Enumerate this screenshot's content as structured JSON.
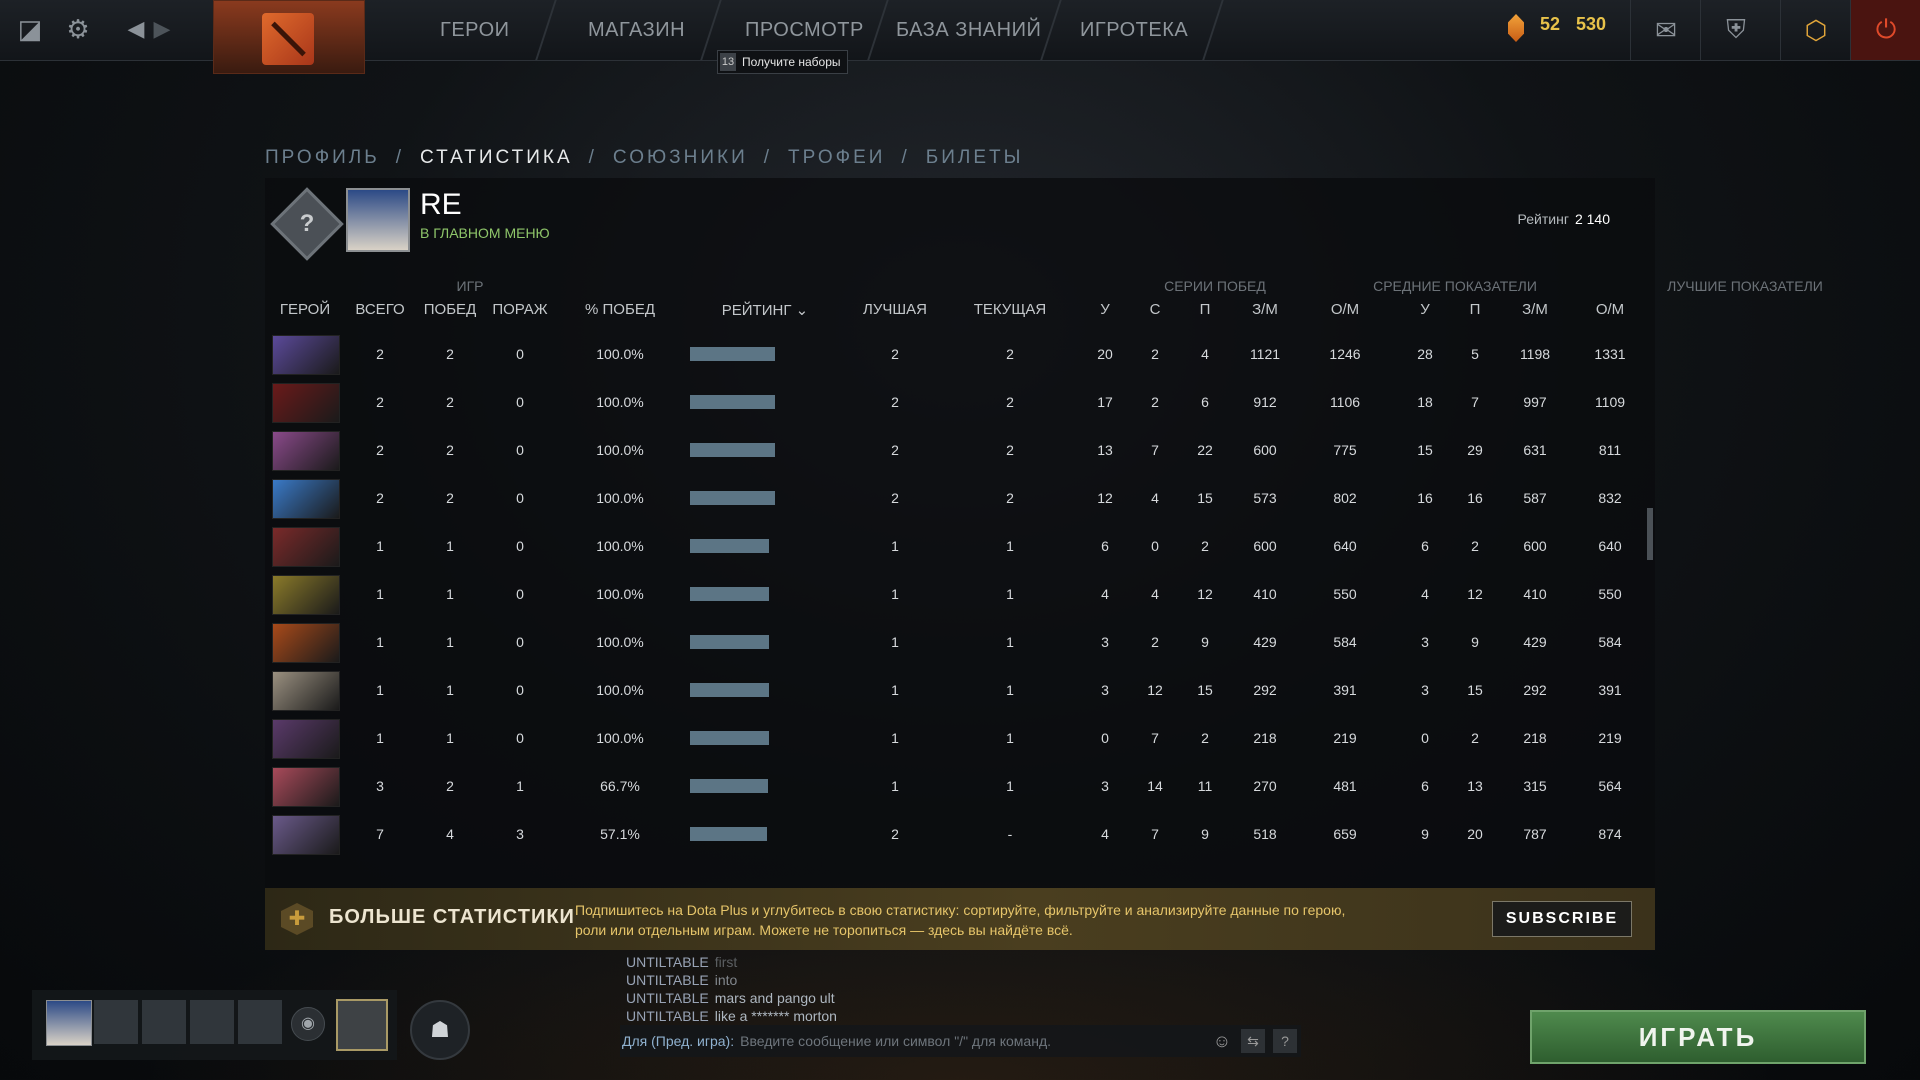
{
  "topbar": {
    "nav": [
      "ГЕРОИ",
      "МАГАЗИН",
      "ПРОСМОТР",
      "БАЗА ЗНАНИЙ",
      "ИГРОТЕКА"
    ],
    "tooltip_count": "13",
    "tooltip_text": "Получите наборы",
    "shards_level": "52",
    "shards_amount": "530"
  },
  "tabs": [
    "ПРОФИЛЬ",
    "СТАТИСТИКА",
    "СОЮЗНИКИ",
    "ТРОФЕИ",
    "БИЛЕТЫ"
  ],
  "active_tab_index": 1,
  "profile": {
    "name": "RE",
    "status": "В ГЛАВНОМ МЕНЮ",
    "rating_label": "Рейтинг",
    "rating_value": "2 140",
    "rank_badge_glyph": "?"
  },
  "table": {
    "groups": {
      "games": "ИГР",
      "streaks": "СЕРИИ ПОБЕД",
      "avg": "СРЕДНИЕ ПОКАЗАТЕЛИ",
      "best": "ЛУЧШИЕ ПОКАЗАТЕЛИ"
    },
    "columns": {
      "hero": "ГЕРОЙ",
      "total": "ВСЕГО",
      "wins": "ПОБЕД",
      "losses": "ПОРАЖ",
      "winrate": "% ПОБЕД",
      "rating": "РЕЙТИНГ",
      "best_streak": "ЛУЧШАЯ",
      "current_streak": "ТЕКУЩАЯ",
      "avg_k": "У",
      "avg_d": "С",
      "avg_a": "П",
      "avg_gpm": "З/М",
      "avg_xpm": "О/М",
      "best_k": "У",
      "best_a": "П",
      "best_gpm": "З/М",
      "best_xpm": "О/М"
    },
    "rows": [
      {
        "hero_color": "#5b4a9a",
        "total": "2",
        "wins": "2",
        "losses": "0",
        "winrate": "100.0%",
        "rating_fill": 0.94,
        "best_streak": "2",
        "current_streak": "2",
        "avg_k": "20",
        "avg_d": "2",
        "avg_a": "4",
        "avg_gpm": "1121",
        "avg_xpm": "1246",
        "best_k": "28",
        "best_a": "5",
        "best_gpm": "1198",
        "best_xpm": "1331"
      },
      {
        "hero_color": "#6a1a1a",
        "total": "2",
        "wins": "2",
        "losses": "0",
        "winrate": "100.0%",
        "rating_fill": 0.94,
        "best_streak": "2",
        "current_streak": "2",
        "avg_k": "17",
        "avg_d": "2",
        "avg_a": "6",
        "avg_gpm": "912",
        "avg_xpm": "1106",
        "best_k": "18",
        "best_a": "7",
        "best_gpm": "997",
        "best_xpm": "1109"
      },
      {
        "hero_color": "#8a4a8a",
        "total": "2",
        "wins": "2",
        "losses": "0",
        "winrate": "100.0%",
        "rating_fill": 0.94,
        "best_streak": "2",
        "current_streak": "2",
        "avg_k": "13",
        "avg_d": "7",
        "avg_a": "22",
        "avg_gpm": "600",
        "avg_xpm": "775",
        "best_k": "15",
        "best_a": "29",
        "best_gpm": "631",
        "best_xpm": "811"
      },
      {
        "hero_color": "#3a7ac8",
        "total": "2",
        "wins": "2",
        "losses": "0",
        "winrate": "100.0%",
        "rating_fill": 0.94,
        "best_streak": "2",
        "current_streak": "2",
        "avg_k": "12",
        "avg_d": "4",
        "avg_a": "15",
        "avg_gpm": "573",
        "avg_xpm": "802",
        "best_k": "16",
        "best_a": "16",
        "best_gpm": "587",
        "best_xpm": "832"
      },
      {
        "hero_color": "#7a2a2a",
        "total": "1",
        "wins": "1",
        "losses": "0",
        "winrate": "100.0%",
        "rating_fill": 0.88,
        "best_streak": "1",
        "current_streak": "1",
        "avg_k": "6",
        "avg_d": "0",
        "avg_a": "2",
        "avg_gpm": "600",
        "avg_xpm": "640",
        "best_k": "6",
        "best_a": "2",
        "best_gpm": "600",
        "best_xpm": "640"
      },
      {
        "hero_color": "#8a7a2a",
        "total": "1",
        "wins": "1",
        "losses": "0",
        "winrate": "100.0%",
        "rating_fill": 0.88,
        "best_streak": "1",
        "current_streak": "1",
        "avg_k": "4",
        "avg_d": "4",
        "avg_a": "12",
        "avg_gpm": "410",
        "avg_xpm": "550",
        "best_k": "4",
        "best_a": "12",
        "best_gpm": "410",
        "best_xpm": "550"
      },
      {
        "hero_color": "#a84a1a",
        "total": "1",
        "wins": "1",
        "losses": "0",
        "winrate": "100.0%",
        "rating_fill": 0.88,
        "best_streak": "1",
        "current_streak": "1",
        "avg_k": "3",
        "avg_d": "2",
        "avg_a": "9",
        "avg_gpm": "429",
        "avg_xpm": "584",
        "best_k": "3",
        "best_a": "9",
        "best_gpm": "429",
        "best_xpm": "584"
      },
      {
        "hero_color": "#9a9080",
        "total": "1",
        "wins": "1",
        "losses": "0",
        "winrate": "100.0%",
        "rating_fill": 0.88,
        "best_streak": "1",
        "current_streak": "1",
        "avg_k": "3",
        "avg_d": "12",
        "avg_a": "15",
        "avg_gpm": "292",
        "avg_xpm": "391",
        "best_k": "3",
        "best_a": "15",
        "best_gpm": "292",
        "best_xpm": "391"
      },
      {
        "hero_color": "#5a3a6a",
        "total": "1",
        "wins": "1",
        "losses": "0",
        "winrate": "100.0%",
        "rating_fill": 0.88,
        "best_streak": "1",
        "current_streak": "1",
        "avg_k": "0",
        "avg_d": "7",
        "avg_a": "2",
        "avg_gpm": "218",
        "avg_xpm": "219",
        "best_k": "0",
        "best_a": "2",
        "best_gpm": "218",
        "best_xpm": "219"
      },
      {
        "hero_color": "#a84a5a",
        "total": "3",
        "wins": "2",
        "losses": "1",
        "winrate": "66.7%",
        "rating_fill": 0.87,
        "best_streak": "1",
        "current_streak": "1",
        "avg_k": "3",
        "avg_d": "14",
        "avg_a": "11",
        "avg_gpm": "270",
        "avg_xpm": "481",
        "best_k": "6",
        "best_a": "13",
        "best_gpm": "315",
        "best_xpm": "564"
      },
      {
        "hero_color": "#6a5a8a",
        "total": "7",
        "wins": "4",
        "losses": "3",
        "winrate": "57.1%",
        "rating_fill": 0.86,
        "best_streak": "2",
        "current_streak": "-",
        "avg_k": "4",
        "avg_d": "7",
        "avg_a": "9",
        "avg_gpm": "518",
        "avg_xpm": "659",
        "best_k": "9",
        "best_a": "20",
        "best_gpm": "787",
        "best_xpm": "874"
      }
    ]
  },
  "dota_plus": {
    "title": "БОЛЬШЕ СТАТИСТИКИ",
    "description": "Подпишитесь на Dota Plus и углубитесь в свою статистику: сортируйте, фильтруйте и анализируйте данные по герою, роли или отдельным играм. Можете не торопиться — здесь вы найдёте всё.",
    "button": "SUBSCRIBE"
  },
  "chat": {
    "messages": [
      {
        "name": "UNTILTABLE",
        "text": "first"
      },
      {
        "name": "UNTILTABLE",
        "text": "into"
      },
      {
        "name": "UNTILTABLE",
        "text": "mars and pango ult"
      },
      {
        "name": "UNTILTABLE",
        "text": "like a ******* morton"
      }
    ],
    "channel": "Для (Пред. игра):",
    "placeholder": "Введите сообщение или символ \"/\" для команд."
  },
  "play_button": "ИГРАТЬ"
}
